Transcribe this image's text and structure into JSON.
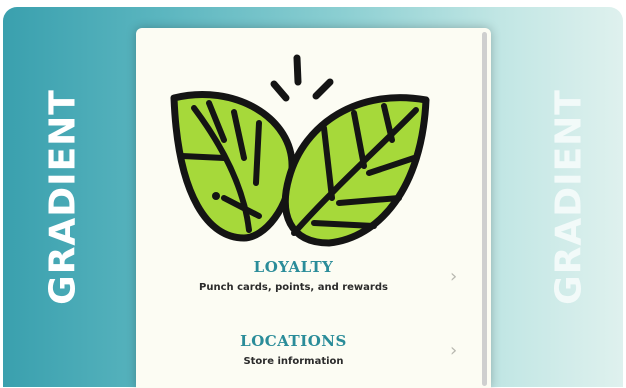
{
  "side_labels": {
    "left": "GRADIENT",
    "right": "GRADIENT"
  },
  "menu": {
    "items": [
      {
        "title": "LOYALTY",
        "subtitle": "Punch cards, points, and rewards",
        "icon": "chevron-right-icon"
      },
      {
        "title": "LOCATIONS",
        "subtitle": "Store information",
        "icon": "chevron-right-icon"
      }
    ]
  },
  "colors": {
    "gradient_start": "#3aa0ae",
    "gradient_end": "#dff1ee",
    "card_background": "#fcfcf3",
    "accent_text": "#2a8c99",
    "leaf_light": "#a6d93a",
    "leaf_dark": "#6fb52e",
    "outline": "#141414"
  },
  "logo": {
    "icon": "leaves-logo-icon"
  }
}
